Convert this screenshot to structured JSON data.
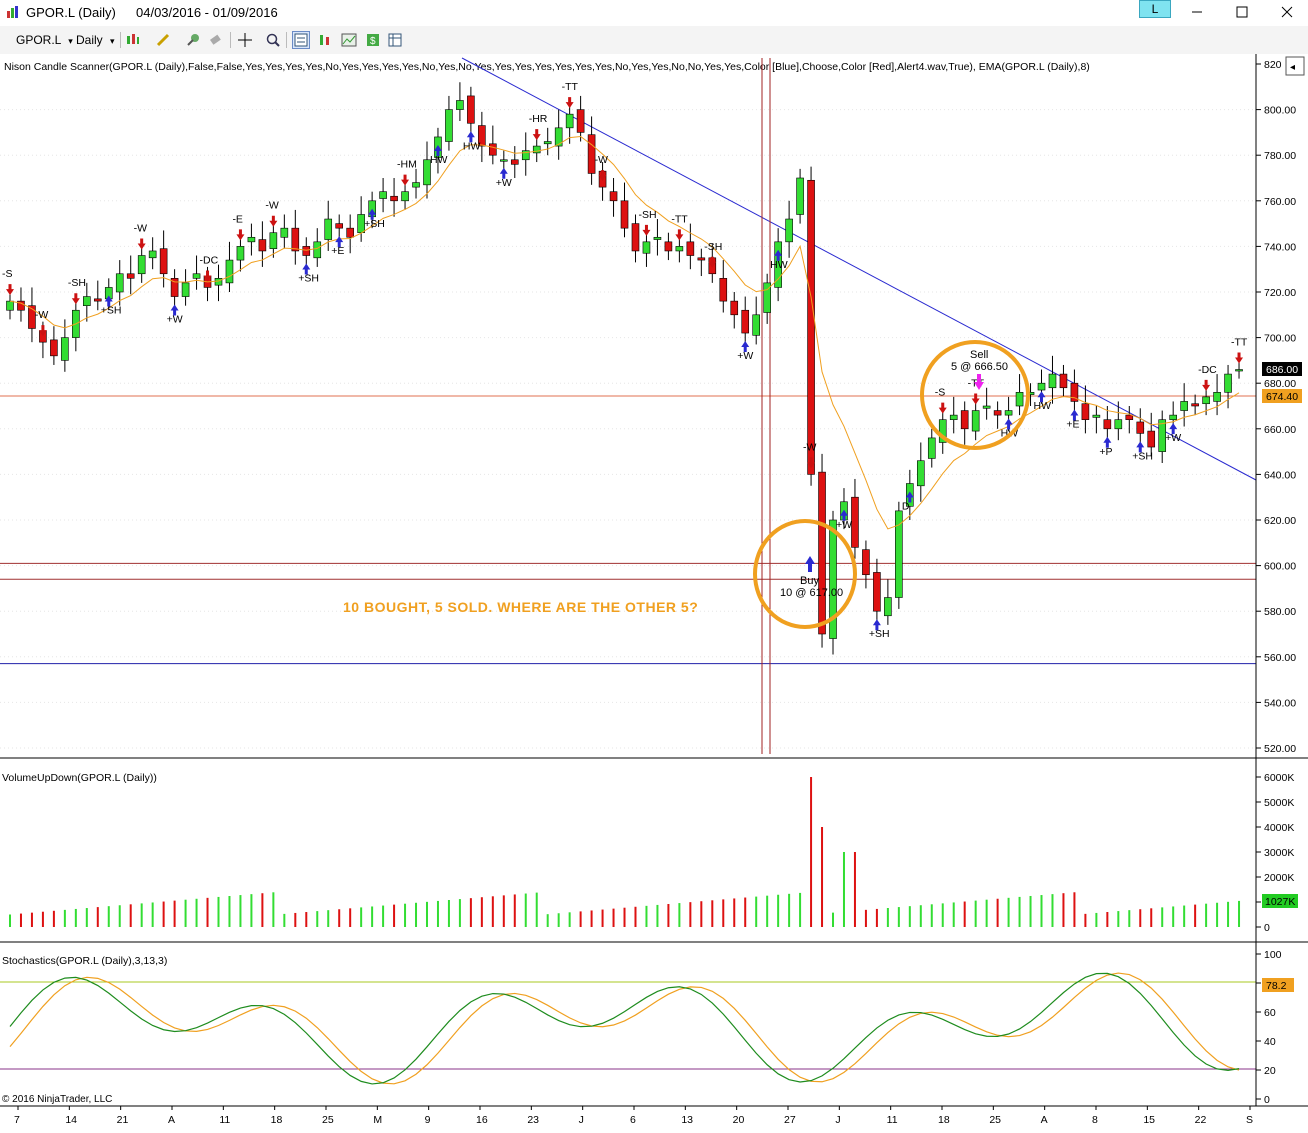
{
  "window": {
    "title": "GPOR.L (Daily)",
    "date_range": "04/03/2016 - 01/09/2016",
    "badge": "L",
    "minimize_icon": "minimize-icon",
    "maximize_icon": "maximize-icon",
    "close_icon": "close-icon"
  },
  "toolbar": {
    "instrument": "GPOR.L",
    "interval": "Daily",
    "icons": [
      "bar-type-icon",
      "draw-pen-icon",
      "crosshair-pin-icon",
      "eraser-icon",
      "crosshair-icon",
      "zoom-icon",
      "data-box-icon",
      "chart-style-icon",
      "properties-icon",
      "strategy-icon",
      "grid-icon"
    ]
  },
  "colors": {
    "up": "#33dd33",
    "down": "#dd1111",
    "ema": "#f0a020",
    "trend": "#1a1acc",
    "annotation": "#f0a020",
    "stoch_k": "#1e8c1e",
    "stoch_d": "#f0a020"
  },
  "price_panel": {
    "indicator_label": "Nison Candle Scanner(GPOR.L (Daily),False,False,Yes,Yes,Yes,Yes,No,Yes,Yes,Yes,Yes,No,Yes,No,Yes,Yes,Yes,Yes,Yes,Yes,Yes,No,Yes,Yes,No,No,Yes,Yes,Color [Blue],Choose,Color [Red],Alert4.wav,True), EMA(GPOR.L (Daily),8)",
    "y_ticks": [
      "820",
      "800.00",
      "780.00",
      "760.00",
      "740.00",
      "720.00",
      "700.00",
      "680.00",
      "660.00",
      "640.00",
      "620.00",
      "600.00",
      "580.00",
      "560.00",
      "540.00",
      "520.00"
    ],
    "last_price": "686.00",
    "ema_value": "674.40",
    "annotation_text": "10 BOUGHT, 5 SOLD. WHERE ARE THE OTHER 5?",
    "buy_label": "Buy",
    "buy_detail": "10 @ 617.00",
    "sell_label": "Sell",
    "sell_detail": "5 @ 666.50",
    "pattern_labels": [
      "-S",
      "-W",
      "-SH",
      "+SH",
      "-W",
      "+W",
      "-DC",
      "-E",
      "-W",
      "+SH",
      "+E",
      "+SH",
      "-HM",
      "HW",
      "HW",
      "+W",
      "-HR",
      "-TT",
      "-W",
      "-SH",
      "-TT",
      "-SH",
      "+W",
      "HW",
      "-W",
      "+W",
      "+SH",
      "D",
      "-S",
      "-TT",
      "HW",
      "HW",
      "+E",
      "+P",
      "+SH",
      "+W",
      "-DC",
      "-TT"
    ],
    "horizontal_levels": [
      {
        "price": "674.40",
        "color": "#e07050"
      },
      {
        "price": "601",
        "color": "#a03030"
      },
      {
        "price": "594",
        "color": "#a03030"
      },
      {
        "price": "557",
        "color": "#2020aa"
      }
    ]
  },
  "volume_panel": {
    "label": "VolumeUpDown(GPOR.L (Daily))",
    "y_ticks": [
      "6000K",
      "5000K",
      "4000K",
      "3000K",
      "2000K",
      "1000K",
      "0"
    ],
    "last_value": "1027K"
  },
  "stoch_panel": {
    "label": "Stochastics(GPOR.L (Daily),3,13,3)",
    "y_ticks": [
      "100",
      "80",
      "60",
      "40",
      "20",
      "0"
    ],
    "last_value": "78.2"
  },
  "x_axis": {
    "labels": [
      "7",
      "14",
      "21",
      "A",
      "11",
      "18",
      "25",
      "M",
      "9",
      "16",
      "23",
      "J",
      "6",
      "13",
      "20",
      "27",
      "J",
      "11",
      "18",
      "25",
      "A",
      "8",
      "15",
      "22",
      "S"
    ]
  },
  "copyright": "© 2016 NinjaTrader, LLC"
}
